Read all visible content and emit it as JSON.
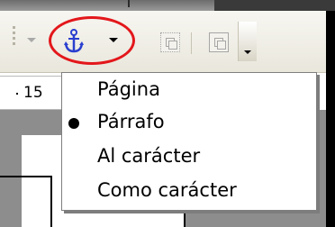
{
  "toolbar": {
    "anchor_button": {
      "icon": "anchor-icon",
      "color": "#2a3fcf",
      "highlight_color": "#e3171b"
    },
    "frame_buttons": [
      {
        "icon": "frame-anchor-icon"
      },
      {
        "icon": "frame-wrap-icon"
      }
    ]
  },
  "ruler": {
    "value": "15"
  },
  "anchor_menu": {
    "items": [
      {
        "label": "Página",
        "selected": false
      },
      {
        "label": "Párrafo",
        "selected": true
      },
      {
        "label": "Al carácter",
        "selected": false
      },
      {
        "label": "Como carácter",
        "selected": false
      }
    ]
  }
}
